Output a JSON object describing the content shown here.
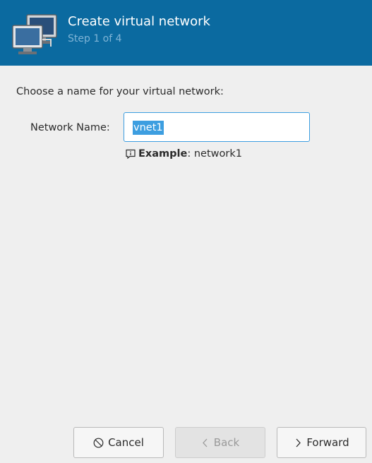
{
  "header": {
    "title": "Create virtual network",
    "step": "Step 1 of 4",
    "icon": "network-computers-icon",
    "background_color": "#0b6aa0"
  },
  "main": {
    "instruction": "Choose a name for your virtual network:",
    "network_name_label": "Network Name:",
    "network_name_value": "vnet1",
    "hint_bold": "Example",
    "hint_rest": ": network1",
    "hint_icon": "info-icon"
  },
  "buttons": {
    "cancel": {
      "label": "Cancel",
      "icon": "cancel-circle-icon",
      "enabled": true
    },
    "back": {
      "label": "Back",
      "icon": "chevron-left-icon",
      "enabled": false
    },
    "forward": {
      "label": "Forward",
      "icon": "chevron-right-icon",
      "enabled": true
    }
  },
  "colors": {
    "accent": "#3d9ee0",
    "window_bg": "#efefef"
  }
}
